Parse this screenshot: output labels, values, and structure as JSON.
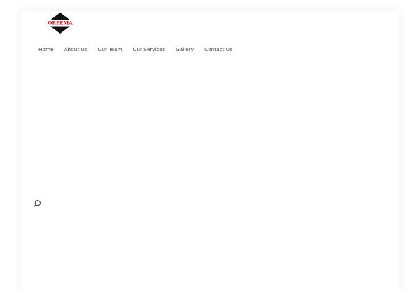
{
  "brand": {
    "logo_text": "ORFEMA",
    "logo_bg": "#111111",
    "logo_band": "#ffffff",
    "logo_text_color": "#d01818"
  },
  "nav": {
    "items": [
      {
        "label": "Home"
      },
      {
        "label": "About Us"
      },
      {
        "label": "Our Team"
      },
      {
        "label": "Our Services"
      },
      {
        "label": "Gallery"
      },
      {
        "label": "Contact Us"
      }
    ]
  },
  "search": {
    "icon": "search-icon"
  }
}
